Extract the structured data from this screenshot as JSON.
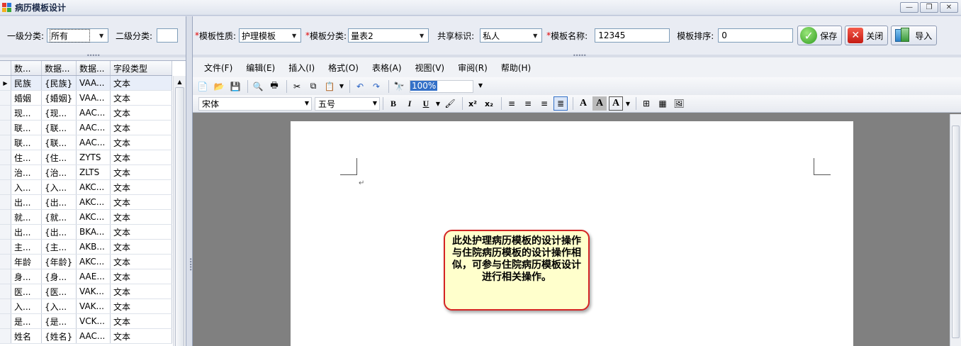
{
  "window": {
    "title": "病历模板设计",
    "buttons": {
      "minimize": "—",
      "restore": "❐",
      "close": "✕"
    }
  },
  "left_filter": {
    "level1_label": "一级分类:",
    "level1_value": "所有",
    "level2_label": "二级分类:",
    "level2_value": ""
  },
  "field_grid": {
    "columns": [
      "数...",
      "数据...",
      "数据...",
      "字段类型"
    ],
    "rows": [
      [
        "民族",
        "{民族}",
        "VAA...",
        "文本"
      ],
      [
        "婚姻",
        "{婚姻}",
        "VAA...",
        "文本"
      ],
      [
        "现...",
        "{现...",
        "AAC...",
        "文本"
      ],
      [
        "联...",
        "{联...",
        "AAC...",
        "文本"
      ],
      [
        "联...",
        "{联...",
        "AAC...",
        "文本"
      ],
      [
        "住...",
        "{住...",
        "ZYTS",
        "文本"
      ],
      [
        "治...",
        "{治...",
        "ZLTS",
        "文本"
      ],
      [
        "入...",
        "{入...",
        "AKC...",
        "文本"
      ],
      [
        "出...",
        "{出...",
        "AKC...",
        "文本"
      ],
      [
        "就...",
        "{就...",
        "AKC...",
        "文本"
      ],
      [
        "出...",
        "{出...",
        "BKA...",
        "文本"
      ],
      [
        "主...",
        "{主...",
        "AKB...",
        "文本"
      ],
      [
        "年龄",
        "{年龄}",
        "AKC...",
        "文本"
      ],
      [
        "身...",
        "{身...",
        "AAE...",
        "文本"
      ],
      [
        "医...",
        "{医...",
        "VAK...",
        "文本"
      ],
      [
        "入...",
        "{入...",
        "VAK...",
        "文本"
      ],
      [
        "是...",
        "{是...",
        "VCK...",
        "文本"
      ],
      [
        "姓名",
        "{姓名}",
        "AAC...",
        "文本"
      ]
    ]
  },
  "top_form": {
    "nature_label": "模板性质:",
    "nature_value": "护理模板",
    "category_label": "模板分类:",
    "category_value": "量表2",
    "share_label": "共享标识:",
    "share_value": "私人",
    "name_label": "模板名称:",
    "name_value": "12345",
    "order_label": "模板排序:",
    "order_value": "0",
    "required_mark": "*",
    "save_label": "保存",
    "close_label": "关闭",
    "import_label": "导入"
  },
  "menu": [
    "文件(F)",
    "编辑(E)",
    "插入(I)",
    "格式(O)",
    "表格(A)",
    "视图(V)",
    "审阅(R)",
    "帮助(H)"
  ],
  "toolbar": {
    "zoom": "100%",
    "font_name": "宋体",
    "font_size": "五号"
  },
  "document": {
    "paragraph_mark": "↵",
    "callout_text": "此处护理病历模板的设计操作与住院病历模板的设计操作相似，可参与住院病历模板设计进行相关操作。"
  },
  "colors": {
    "accent": "#3370c8",
    "callout_border": "#d42424",
    "callout_fill": "#ffffcc",
    "required": "#e00000"
  }
}
